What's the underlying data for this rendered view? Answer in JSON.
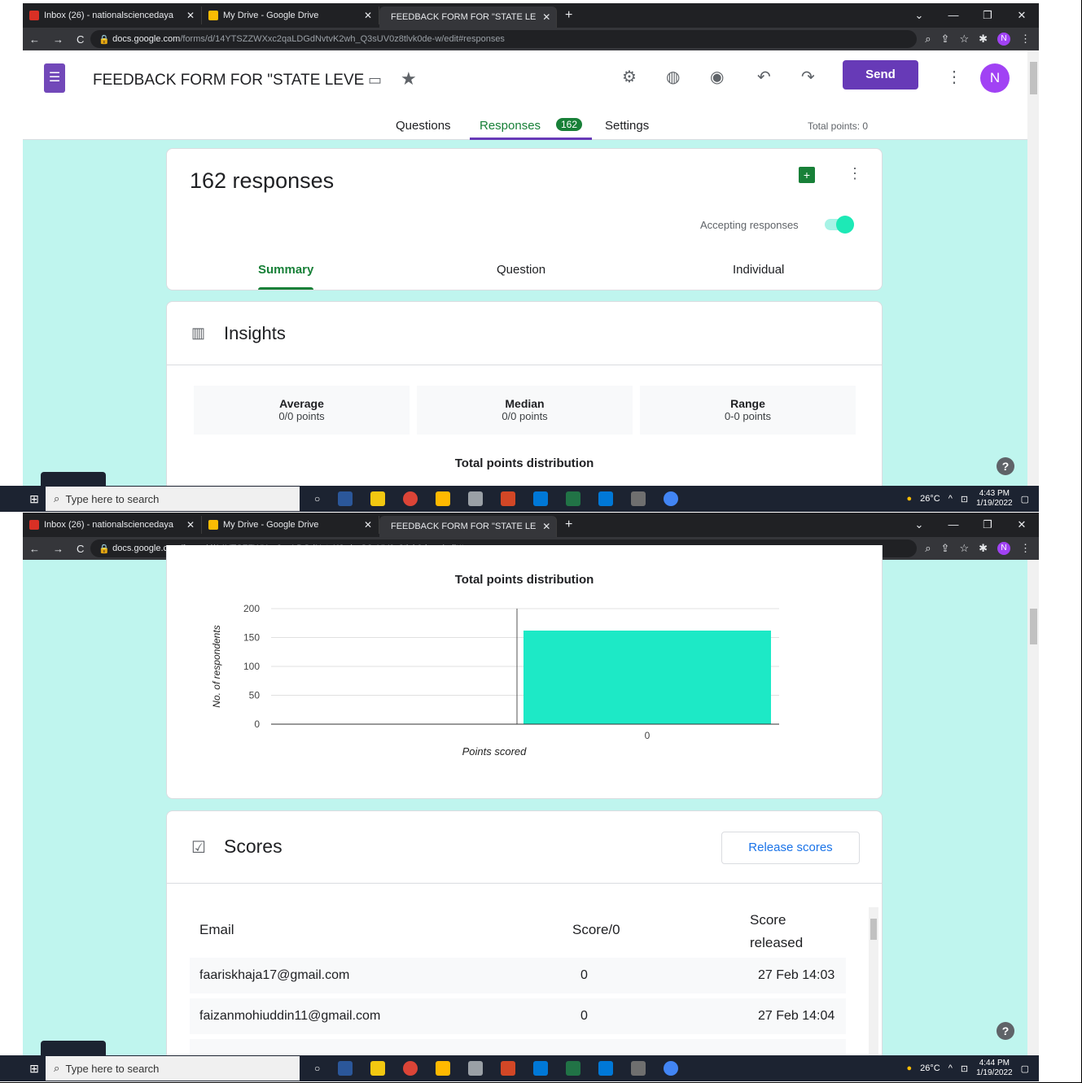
{
  "browser": {
    "tabs": [
      {
        "label": "Inbox (26) - nationalsciencedaya",
        "color": "#d93025"
      },
      {
        "label": "My Drive - Google Drive",
        "color": "#fbbc04"
      },
      {
        "label": "FEEDBACK FORM FOR \"STATE LE",
        "color": "#7248b9"
      }
    ],
    "url_host": "docs.google.com",
    "url_path": "/forms/d/14YTSZZWXxc2qaLDGdNvtvK2wh_Q3sUV0z8tlvk0de-w/edit#responses",
    "avatar_letter": "N"
  },
  "header": {
    "form_title": "FEEDBACK FORM  FOR \"STATE LEVE",
    "send_label": "Send",
    "avatar_letter": "N",
    "tabs": {
      "questions": "Questions",
      "responses": "Responses",
      "responses_count": "162",
      "settings": "Settings"
    },
    "total_points": "Total points: 0"
  },
  "responses_card": {
    "title": "162 responses",
    "accepting_label": "Accepting responses",
    "subtabs": {
      "summary": "Summary",
      "question": "Question",
      "individual": "Individual"
    }
  },
  "insights": {
    "title": "Insights",
    "stats": [
      {
        "label": "Average",
        "value": "0/0 points"
      },
      {
        "label": "Median",
        "value": "0/0 points"
      },
      {
        "label": "Range",
        "value": "0-0 points"
      }
    ],
    "dist_title": "Total points distribution"
  },
  "chart_data": {
    "type": "bar",
    "title": "Total points distribution",
    "categories": [
      "0"
    ],
    "values": [
      162
    ],
    "xlabel": "Points scored",
    "ylabel": "No. of respondents",
    "ylim": [
      0,
      200
    ],
    "yticks": [
      0,
      50,
      100,
      150,
      200
    ],
    "bar_color": "#1de9c6",
    "grid": true
  },
  "scores": {
    "title": "Scores",
    "release_label": "Release scores",
    "headers": {
      "email": "Email",
      "score": "Score/0",
      "released_1": "Score",
      "released_2": "released"
    },
    "rows": [
      {
        "email": "faariskhaja17@gmail.com",
        "score": "0",
        "released": "27 Feb 14:03"
      },
      {
        "email": "faizanmohiuddin11@gmail.com",
        "score": "0",
        "released": "27 Feb 14:04"
      }
    ]
  },
  "taskbar": {
    "search_placeholder": "Type here to search",
    "temp": "26°C",
    "time_1": "4:43 PM",
    "time_2": "4:44 PM",
    "date": "1/19/2022"
  },
  "colors": {
    "accent": "#673ab7",
    "green": "#188038",
    "bg": "#bff5ee"
  }
}
